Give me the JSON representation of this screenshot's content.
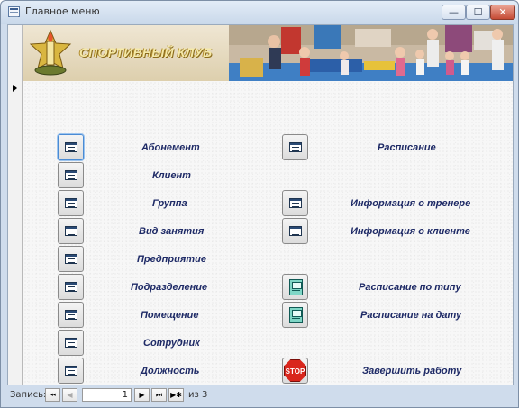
{
  "window": {
    "title": "Главное меню"
  },
  "header": {
    "club_title": "СПОРТИВНЫЙ КЛУБ"
  },
  "left_menu": [
    {
      "label": "Абонемент",
      "icon": "form-icon"
    },
    {
      "label": "Клиент",
      "icon": "form-icon"
    },
    {
      "label": "Группа",
      "icon": "form-icon"
    },
    {
      "label": "Вид занятия",
      "icon": "form-icon"
    },
    {
      "label": "Предприятие",
      "icon": "form-icon"
    },
    {
      "label": "Подразделение",
      "icon": "form-icon"
    },
    {
      "label": "Помещение",
      "icon": "form-icon"
    },
    {
      "label": "Сотрудник",
      "icon": "form-icon"
    },
    {
      "label": "Должность",
      "icon": "form-icon"
    }
  ],
  "right_menu": [
    {
      "label": "Расписание",
      "icon": "form-icon"
    },
    {
      "label": "Информация о тренере",
      "icon": "form-icon"
    },
    {
      "label": "Информация о клиенте",
      "icon": "form-icon"
    },
    {
      "label": "Расписание по типу",
      "icon": "report-icon"
    },
    {
      "label": "Расписание на дату",
      "icon": "report-icon"
    },
    {
      "label": "Завершить работу",
      "icon": "stop-icon",
      "icon_text": "STOP"
    }
  ],
  "navigator": {
    "label": "Запись:",
    "current": "1",
    "total": "из 3",
    "first": "⏮",
    "prev": "◀",
    "next": "▶",
    "last": "⏭",
    "new": "▶✱"
  },
  "colors": {
    "label": "#1e2a66",
    "stop": "#d9261c"
  }
}
